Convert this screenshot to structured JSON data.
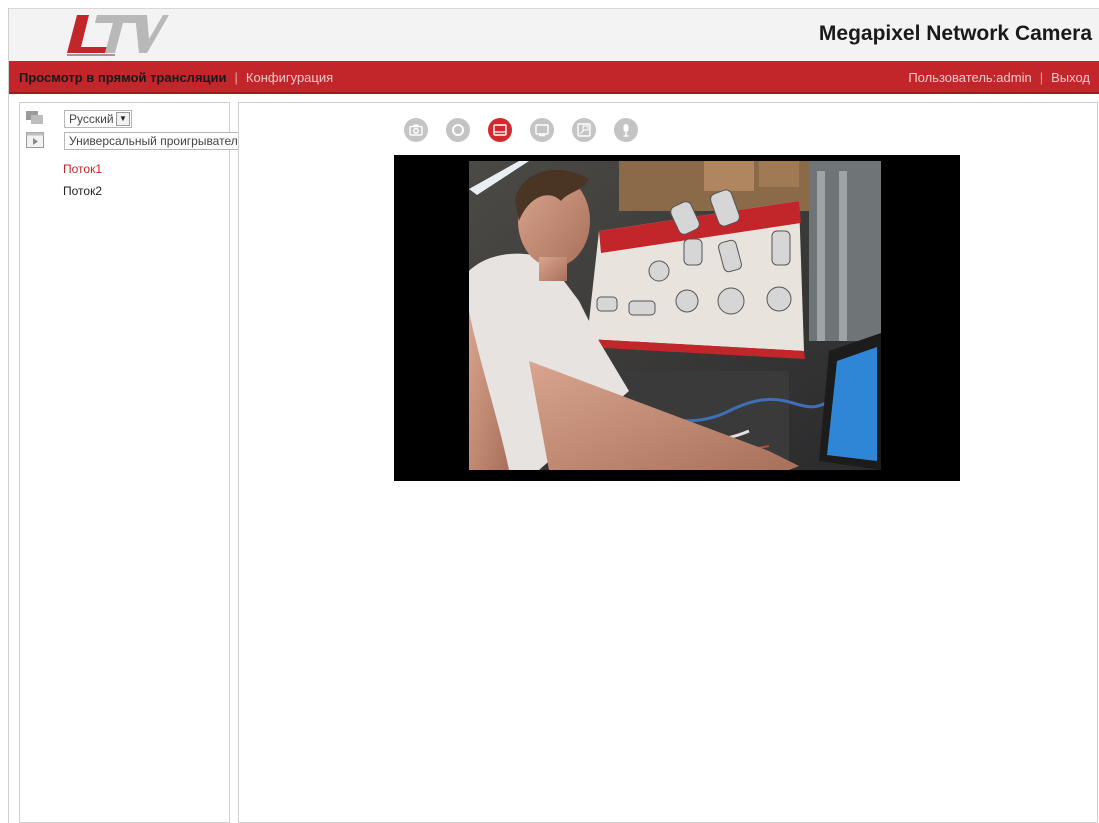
{
  "header": {
    "logo_text": "LTV",
    "title": "Megapixel Network Camera"
  },
  "nav": {
    "live_view": "Просмотр в прямой трансляции",
    "separator": "|",
    "configuration": "Конфигурация",
    "user": "Пользователь:admin",
    "logout": "Выход"
  },
  "sidebar": {
    "language": "Русский",
    "player": "Универсальный проигрыватель",
    "streams": [
      {
        "label": "Поток1",
        "active": true
      },
      {
        "label": "Поток2",
        "active": false
      }
    ]
  },
  "toolbar": {
    "buttons": [
      {
        "name": "snapshot",
        "icon": "camera-icon",
        "active": false
      },
      {
        "name": "record",
        "icon": "record-icon",
        "active": false
      },
      {
        "name": "original-size",
        "icon": "window-icon",
        "active": true
      },
      {
        "name": "fit-window",
        "icon": "monitor-icon",
        "active": false
      },
      {
        "name": "fullscreen",
        "icon": "fullscreen-icon",
        "active": false
      },
      {
        "name": "microphone",
        "icon": "microphone-icon",
        "active": false
      }
    ]
  },
  "colors": {
    "brand_red": "#c3262a",
    "header_bg": "#f3f3f3",
    "icon_gray": "#c4c4c4"
  }
}
